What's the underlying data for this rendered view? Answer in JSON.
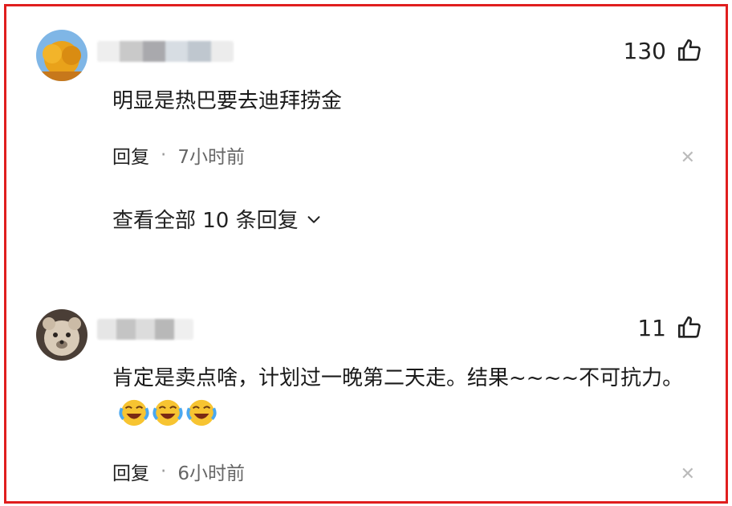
{
  "comments": [
    {
      "likes": "130",
      "text": "明显是热巴要去迪拜捞金",
      "reply_label": "回复",
      "separator": "·",
      "time": "7小时前",
      "view_all": "查看全部 10 条回复"
    },
    {
      "likes": "11",
      "text": "肯定是卖点啥，计划过一晚第二天走。结果~~~~不可抗力。",
      "reply_label": "回复",
      "separator": "·",
      "time": "6小时前"
    }
  ],
  "icons": {
    "like": "thumbs-up-icon",
    "close": "close-icon",
    "expand": "chevron-down-icon",
    "emoji": "laughing-crying-emoji"
  },
  "colors": {
    "frame_border": "#e01e1e",
    "text": "#1a1a1a",
    "meta": "#666666"
  }
}
